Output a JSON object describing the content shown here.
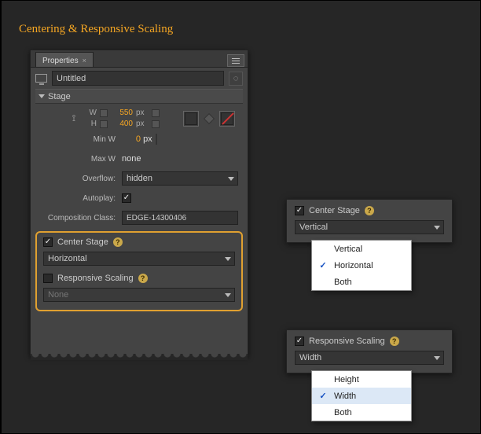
{
  "title": "Centering & Responsive Scaling",
  "panel": {
    "tab_label": "Properties",
    "doc_title": "Untitled",
    "stage_label": "Stage",
    "dim": {
      "w_lbl": "W",
      "w_val": "550",
      "w_unit": "px",
      "h_lbl": "H",
      "h_val": "400",
      "h_unit": "px"
    },
    "minw_lbl": "Min W",
    "minw_val": "0",
    "minw_unit": "px",
    "maxw_lbl": "Max W",
    "maxw_val": "none",
    "overflow_lbl": "Overflow:",
    "overflow_val": "hidden",
    "autoplay_lbl": "Autoplay:",
    "comp_lbl": "Composition Class:",
    "comp_val": "EDGE-14300406",
    "center_stage_lbl": "Center Stage",
    "center_stage_val": "Horizontal",
    "resp_lbl": "Responsive Scaling",
    "resp_val": "None"
  },
  "pop_center": {
    "label": "Center Stage",
    "selected": "Vertical",
    "options": [
      "Vertical",
      "Horizontal",
      "Both"
    ],
    "checked": "Horizontal"
  },
  "pop_resp": {
    "label": "Responsive Scaling",
    "selected": "Width",
    "options": [
      "Height",
      "Width",
      "Both"
    ],
    "checked": "Width",
    "highlight": "Width"
  }
}
